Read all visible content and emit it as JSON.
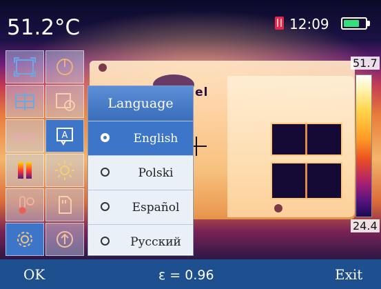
{
  "status_bar": {
    "temperature": "51.2°C",
    "time": "12:09",
    "sd_card_icon": "sd-card-icon",
    "battery_icon": "battery-icon",
    "battery_level": 0.8
  },
  "scene": {
    "logo_text": "nel"
  },
  "color_scale": {
    "max": "51.7",
    "min": "24.4"
  },
  "icon_grid": [
    {
      "name": "area-measure-icon",
      "active": false
    },
    {
      "name": "power-icon",
      "active": false
    },
    {
      "name": "center-point-icon",
      "active": false
    },
    {
      "name": "date-time-icon",
      "active": false
    },
    {
      "name": "emissivity-icon",
      "active": false
    },
    {
      "name": "language-icon",
      "active": true
    },
    {
      "name": "palette-icon",
      "active": false
    },
    {
      "name": "brightness-icon",
      "active": false
    },
    {
      "name": "temperature-settings-icon",
      "active": false
    },
    {
      "name": "storage-icon",
      "active": false
    },
    {
      "name": "settings-gear-icon",
      "active": true
    },
    {
      "name": "upgrade-icon",
      "active": false
    }
  ],
  "language_menu": {
    "title": "Language",
    "options": [
      {
        "label": "English",
        "selected": true
      },
      {
        "label": "Polski",
        "selected": false
      },
      {
        "label": "Español",
        "selected": false
      },
      {
        "label": "Русский",
        "selected": false
      }
    ]
  },
  "bottom_bar": {
    "ok_label": "OK",
    "emissivity": "ε = 0.96",
    "exit_label": "Exit"
  },
  "colors": {
    "accent": "#3d76c9",
    "bottom_bar": "#1e4f8f",
    "battery": "#35e07a",
    "sd_card": "#e8264a"
  }
}
